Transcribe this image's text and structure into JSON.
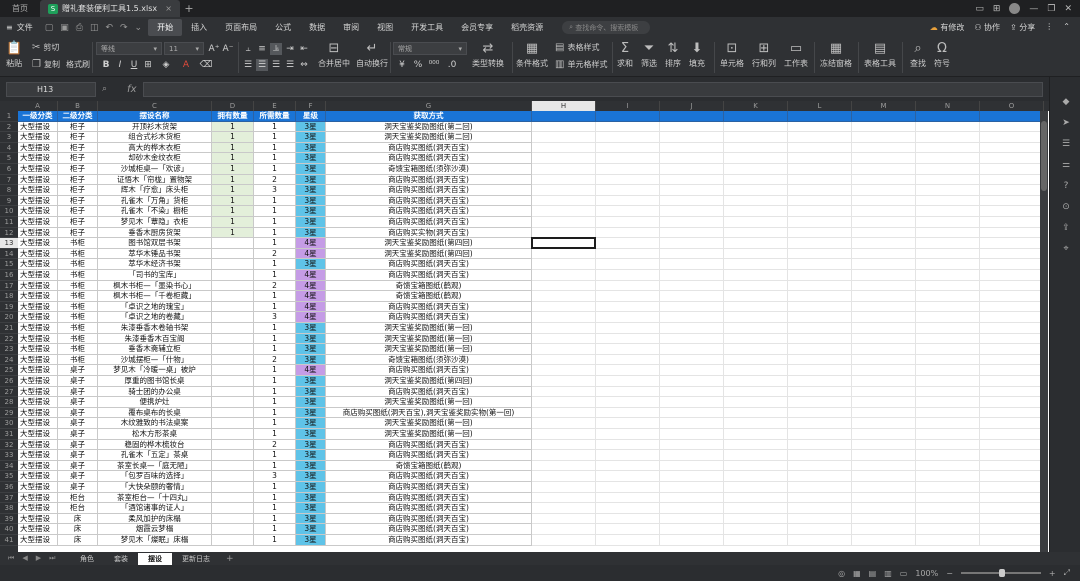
{
  "titlebar": {
    "home_label": "首页",
    "doc_tab_title": "赠礼套装便利工具1.5.xlsx",
    "right_icons": [
      "layout-icon",
      "minimize-icon",
      "maximize-icon",
      "close-icon"
    ]
  },
  "menubar": {
    "file_label": "文件",
    "tabs": [
      "开始",
      "插入",
      "页面布局",
      "公式",
      "数据",
      "审阅",
      "视图",
      "开发工具",
      "会员专享",
      "稻壳资源"
    ],
    "active_tab_index": 0,
    "search_placeholder": "查找命令、搜索模板",
    "unsaved_label": "有修改",
    "collab_label": "协作",
    "share_label": "分享"
  },
  "ribbon": {
    "paste_label": "粘贴",
    "cut_label": "剪切",
    "copy_label": "复制",
    "format_painter_label": "格式刷",
    "font_name": "等线",
    "font_size": "11",
    "merge_label": "合并居中",
    "wrap_label": "自动换行",
    "number_format": "常规",
    "type_convert_label": "类型转换",
    "conditional_label": "条件格式",
    "table_style_label": "表格样式",
    "cell_style_label": "单元格样式",
    "sum_label": "求和",
    "filter_label": "筛选",
    "sort_label": "排序",
    "fill_label": "填充",
    "cell_label": "单元格",
    "rowcol_label": "行和列",
    "worksheet_label": "工作表",
    "freeze_label": "冻结窗格",
    "table_tools_label": "表格工具",
    "find_label": "查找",
    "symbol_label": "符号"
  },
  "formulabar": {
    "name_box": "H13",
    "fx_label": "fx",
    "formula_value": ""
  },
  "sheet": {
    "columns": [
      "A",
      "B",
      "C",
      "D",
      "E",
      "F",
      "G",
      "H",
      "I",
      "J",
      "K",
      "L",
      "M",
      "N",
      "O"
    ],
    "selected_column": "H",
    "selected_row": 13,
    "header": [
      "一级分类",
      "二级分类",
      "摆设名称",
      "拥有数量",
      "所需数量",
      "星级",
      "获取方式"
    ],
    "rows": [
      [
        "大型摆设",
        "柜子",
        "开顶衫木货架",
        "1",
        "1",
        "3星",
        "洞天宝鉴奖励图纸(第二回)"
      ],
      [
        "大型摆设",
        "柜子",
        "组合式衫木货柜",
        "1",
        "1",
        "3星",
        "洞天宝鉴奖励图纸(第二回)"
      ],
      [
        "大型摆设",
        "柜子",
        "高大的桦木衣柜",
        "1",
        "1",
        "3星",
        "商店购买图纸(洞天百宝)"
      ],
      [
        "大型摆设",
        "柜子",
        "却砂木金纹衣柜",
        "1",
        "1",
        "3星",
        "商店购买图纸(洞天百宝)"
      ],
      [
        "大型摆设",
        "柜子",
        "沙城柜桌—「欢谚」",
        "1",
        "1",
        "3星",
        "奇馈宝箱图纸(须弥沙漠)"
      ],
      [
        "大型摆设",
        "柜子",
        "证悟木「帘栊」置物架",
        "1",
        "2",
        "3星",
        "商店购买图纸(洞天百宝)"
      ],
      [
        "大型摆设",
        "柜子",
        "辉木「疗愈」床头柜",
        "1",
        "3",
        "3星",
        "商店购买图纸(洞天百宝)"
      ],
      [
        "大型摆设",
        "柜子",
        "孔雀木「万角」货柜",
        "1",
        "1",
        "3星",
        "商店购买图纸(洞天百宝)"
      ],
      [
        "大型摆设",
        "柜子",
        "孔雀木「不染」橱柜",
        "1",
        "1",
        "3星",
        "商店购买图纸(洞天百宝)"
      ],
      [
        "大型摆设",
        "柜子",
        "梦见木「蕈隐」衣柜",
        "1",
        "1",
        "3星",
        "商店购买图纸(洞天百宝)"
      ],
      [
        "大型摆设",
        "柜子",
        "垂香木厨房货架",
        "1",
        "1",
        "3星",
        "商店购买实物(洞天百宝)"
      ],
      [
        "大型摆设",
        "书柜",
        "图书馆双层书架",
        "",
        "1",
        "4星",
        "洞天宝鉴奖励图纸(第四回)"
      ],
      [
        "大型摆设",
        "书柜",
        "萃华木锤品书架",
        "",
        "2",
        "4星",
        "洞天宝鉴奖励图纸(第四回)"
      ],
      [
        "大型摆设",
        "书柜",
        "萃华木经济书架",
        "",
        "1",
        "3星",
        "商店购买图纸(洞天百宝)"
      ],
      [
        "大型摆设",
        "书柜",
        "「司书的宝库」",
        "",
        "1",
        "4星",
        "商店购买图纸(洞天百宝)"
      ],
      [
        "大型摆设",
        "书柜",
        "枫木书柜—「墨染书心」",
        "",
        "2",
        "4星",
        "奇馈宝箱图纸(鹤观)"
      ],
      [
        "大型摆设",
        "书柜",
        "枫木书柜—「千卷柜藏」",
        "",
        "1",
        "4星",
        "奇馈宝箱图纸(鹤观)"
      ],
      [
        "大型摆设",
        "书柜",
        "「卓识之地的瑰宝」",
        "",
        "1",
        "4星",
        "商店购买图纸(洞天百宝)"
      ],
      [
        "大型摆设",
        "书柜",
        "「卓识之地的卷藏」",
        "",
        "3",
        "4星",
        "商店购买图纸(洞天百宝)"
      ],
      [
        "大型摆设",
        "书柜",
        "朱漆垂香木卷轴书架",
        "",
        "1",
        "3星",
        "洞天宝鉴奖励图纸(第一回)"
      ],
      [
        "大型摆设",
        "书柜",
        "朱漆垂香木百宝阁",
        "",
        "1",
        "3星",
        "洞天宝鉴奖励图纸(第一回)"
      ],
      [
        "大型摆设",
        "书柜",
        "垂香木斋辅立柜",
        "",
        "1",
        "3星",
        "洞天宝鉴奖励图纸(第一回)"
      ],
      [
        "大型摆设",
        "书柜",
        "沙城摆柜—「什物」",
        "",
        "2",
        "3星",
        "奇馈宝箱图纸(须弥沙漠)"
      ],
      [
        "大型摆设",
        "桌子",
        "梦见木「冷暖一桌」被炉",
        "",
        "1",
        "4星",
        "商店购买图纸(洞天百宝)"
      ],
      [
        "大型摆设",
        "桌子",
        "厚重的图书馆长桌",
        "",
        "1",
        "3星",
        "洞天宝鉴奖励图纸(第四回)"
      ],
      [
        "大型摆设",
        "桌子",
        "骑士团的办公桌",
        "",
        "1",
        "3星",
        "商店购买图纸(洞天百宝)"
      ],
      [
        "大型摆设",
        "桌子",
        "便携炉灶",
        "",
        "1",
        "3星",
        "洞天宝鉴奖励图纸(第一回)"
      ],
      [
        "大型摆设",
        "桌子",
        "覆布桌布的长桌",
        "",
        "1",
        "3星",
        "商店购买图纸(洞天百宝),洞天宝鉴奖励实物(第一回)"
      ],
      [
        "大型摆设",
        "桌子",
        "木纹雅致的书法桌案",
        "",
        "1",
        "3星",
        "洞天宝鉴奖励图纸(第一回)"
      ],
      [
        "大型摆设",
        "桌子",
        "松木方形茶桌",
        "",
        "1",
        "3星",
        "洞天宝鉴奖励图纸(第一回)"
      ],
      [
        "大型摆设",
        "桌子",
        "稳固的桦木梳妆台",
        "",
        "2",
        "3星",
        "商店购买图纸(洞天百宝)"
      ],
      [
        "大型摆设",
        "桌子",
        "孔雀木「五定」茶桌",
        "",
        "1",
        "3星",
        "商店购买图纸(洞天百宝)"
      ],
      [
        "大型摆设",
        "桌子",
        "茶室长桌—「庭无陋」",
        "",
        "1",
        "3星",
        "奇馈宝箱图纸(鹤观)"
      ],
      [
        "大型摆设",
        "桌子",
        "「包罗百味的选择」",
        "",
        "3",
        "3星",
        "商店购买图纸(洞天百宝)"
      ],
      [
        "大型摆设",
        "桌子",
        "「大快朵颐的奢情」",
        "",
        "1",
        "3星",
        "商店购买图纸(洞天百宝)"
      ],
      [
        "大型摆设",
        "柜台",
        "茶室柜台—「十四丸」",
        "",
        "1",
        "3星",
        "商店购买图纸(洞天百宝)"
      ],
      [
        "大型摆设",
        "柜台",
        "「酒馆诸事的证人」",
        "",
        "1",
        "3星",
        "商店购买图纸(洞天百宝)"
      ],
      [
        "大型摆设",
        "床",
        "柔风加护的床榻",
        "",
        "1",
        "3星",
        "商店购买图纸(洞天百宝)"
      ],
      [
        "大型摆设",
        "床",
        "烟霞云梦榻",
        "",
        "1",
        "3星",
        "商店购买图纸(洞天百宝)"
      ],
      [
        "大型摆设",
        "床",
        "梦见木「燦眠」床榻",
        "",
        "1",
        "3星",
        "商店购买图纸(洞天百宝)"
      ]
    ]
  },
  "sheet_tabs": [
    "角色",
    "套装",
    "摆设",
    "更新日志"
  ],
  "active_sheet_index": 2,
  "statusbar": {
    "zoom": "100%"
  },
  "colors": {
    "header_blue": "#1a74d6",
    "star3_blue": "#5fc3e8",
    "star4_purple": "#c59ce6",
    "owned_green": "#e3efda"
  }
}
